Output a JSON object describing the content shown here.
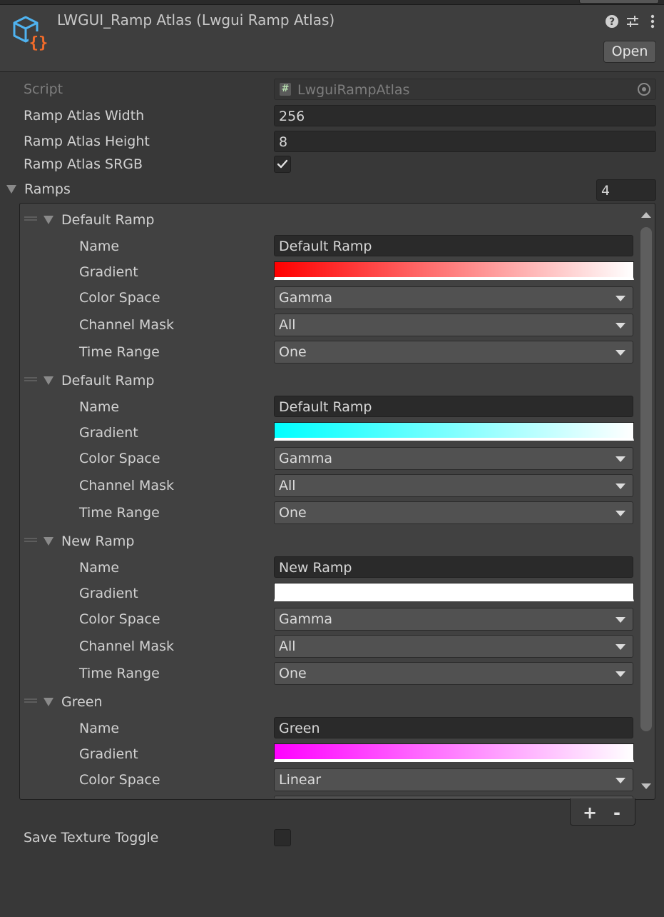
{
  "header": {
    "title": "LWGUI_Ramp Atlas (Lwgui Ramp Atlas)",
    "open_label": "Open",
    "script_icon": "cube-braces-icon",
    "help_icon": "help-icon",
    "preset_icon": "sliders-icon",
    "more_icon": "kebab-menu-icon"
  },
  "fields": {
    "script": {
      "label": "Script",
      "value": "LwguiRampAtlas"
    },
    "width": {
      "label": "Ramp Atlas Width",
      "value": "256"
    },
    "height": {
      "label": "Ramp Atlas Height",
      "value": "8"
    },
    "srgb": {
      "label": "Ramp Atlas SRGB",
      "checked": true
    },
    "ramps": {
      "label": "Ramps",
      "count": "4"
    },
    "save_toggle": {
      "label": "Save Texture Toggle",
      "checked": false
    }
  },
  "row_labels": {
    "name": "Name",
    "gradient": "Gradient",
    "color_space": "Color Space",
    "channel_mask": "Channel Mask",
    "time_range": "Time Range"
  },
  "ramps": [
    {
      "title": "Default Ramp",
      "name": "Default Ramp",
      "gradient_from": "#ff0000",
      "gradient_to": "#ffffff",
      "color_space": "Gamma",
      "channel_mask": "All",
      "time_range": "One"
    },
    {
      "title": "Default Ramp",
      "name": "Default Ramp",
      "gradient_from": "#00ffff",
      "gradient_to": "#ffffff",
      "color_space": "Gamma",
      "channel_mask": "All",
      "time_range": "One"
    },
    {
      "title": "New Ramp",
      "name": "New Ramp",
      "gradient_from": "#ffffff",
      "gradient_to": "#ffffff",
      "color_space": "Gamma",
      "channel_mask": "All",
      "time_range": "One"
    },
    {
      "title": "Green",
      "name": "Green",
      "gradient_from": "#ff00ff",
      "gradient_to": "#ffffff",
      "color_space": "Linear"
    }
  ],
  "list_footer": {
    "add": "+",
    "remove": "-"
  },
  "colors": {
    "background": "#383838",
    "field": "#2a2a2a",
    "dropdown": "#515151",
    "script_icon_blue": "#4fb3f0",
    "script_icon_orange": "#f26b2a"
  }
}
